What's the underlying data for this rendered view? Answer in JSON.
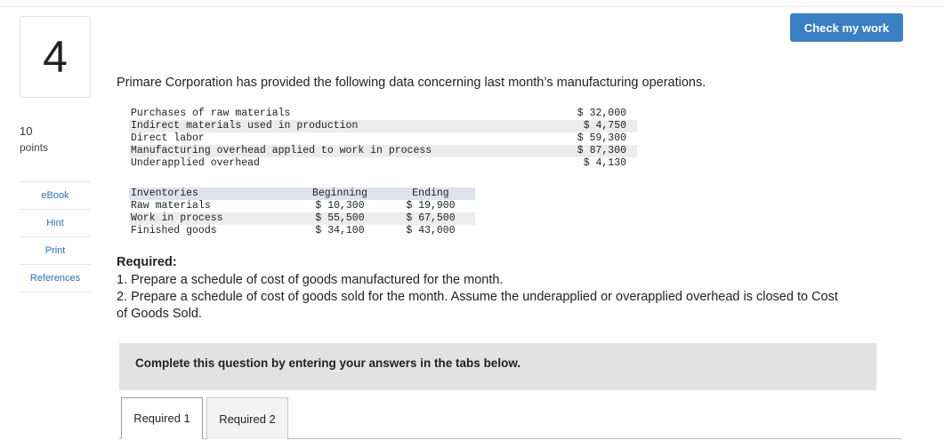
{
  "question": {
    "number": "4",
    "points_value": "10",
    "points_label": "points"
  },
  "sidebar": {
    "links": [
      "eBook",
      "Hint",
      "Print",
      "References"
    ]
  },
  "header": {
    "check_button": "Check my work"
  },
  "intro": "Primare Corporation has provided the following data concerning last month’s manufacturing operations.",
  "costs": [
    {
      "label": "Purchases of raw materials",
      "value": "$ 32,000"
    },
    {
      "label": "Indirect materials used in production",
      "value": "$ 4,750"
    },
    {
      "label": "Direct labor",
      "value": "$ 59,300"
    },
    {
      "label": "Manufacturing overhead applied to work in process",
      "value": "$ 87,300"
    },
    {
      "label": "Underapplied overhead",
      "value": "$ 4,130"
    }
  ],
  "inventories": {
    "headers": [
      "Inventories",
      "Beginning",
      "Ending"
    ],
    "rows": [
      [
        "Raw materials",
        "$ 10,300",
        "$ 19,900"
      ],
      [
        "Work in process",
        "$ 55,500",
        "$ 67,500"
      ],
      [
        "Finished goods",
        "$ 34,100",
        "$ 43,000"
      ]
    ]
  },
  "required": {
    "title": "Required:",
    "items": [
      "1. Prepare a schedule of cost of goods manufactured for the month.",
      "2. Prepare a schedule of cost of goods sold for the month. Assume the underapplied or overapplied overhead is closed to Cost",
      "of Goods Sold."
    ]
  },
  "banner": "Complete this question by entering your answers in the tabs below.",
  "tabs": [
    "Required 1",
    "Required 2"
  ]
}
